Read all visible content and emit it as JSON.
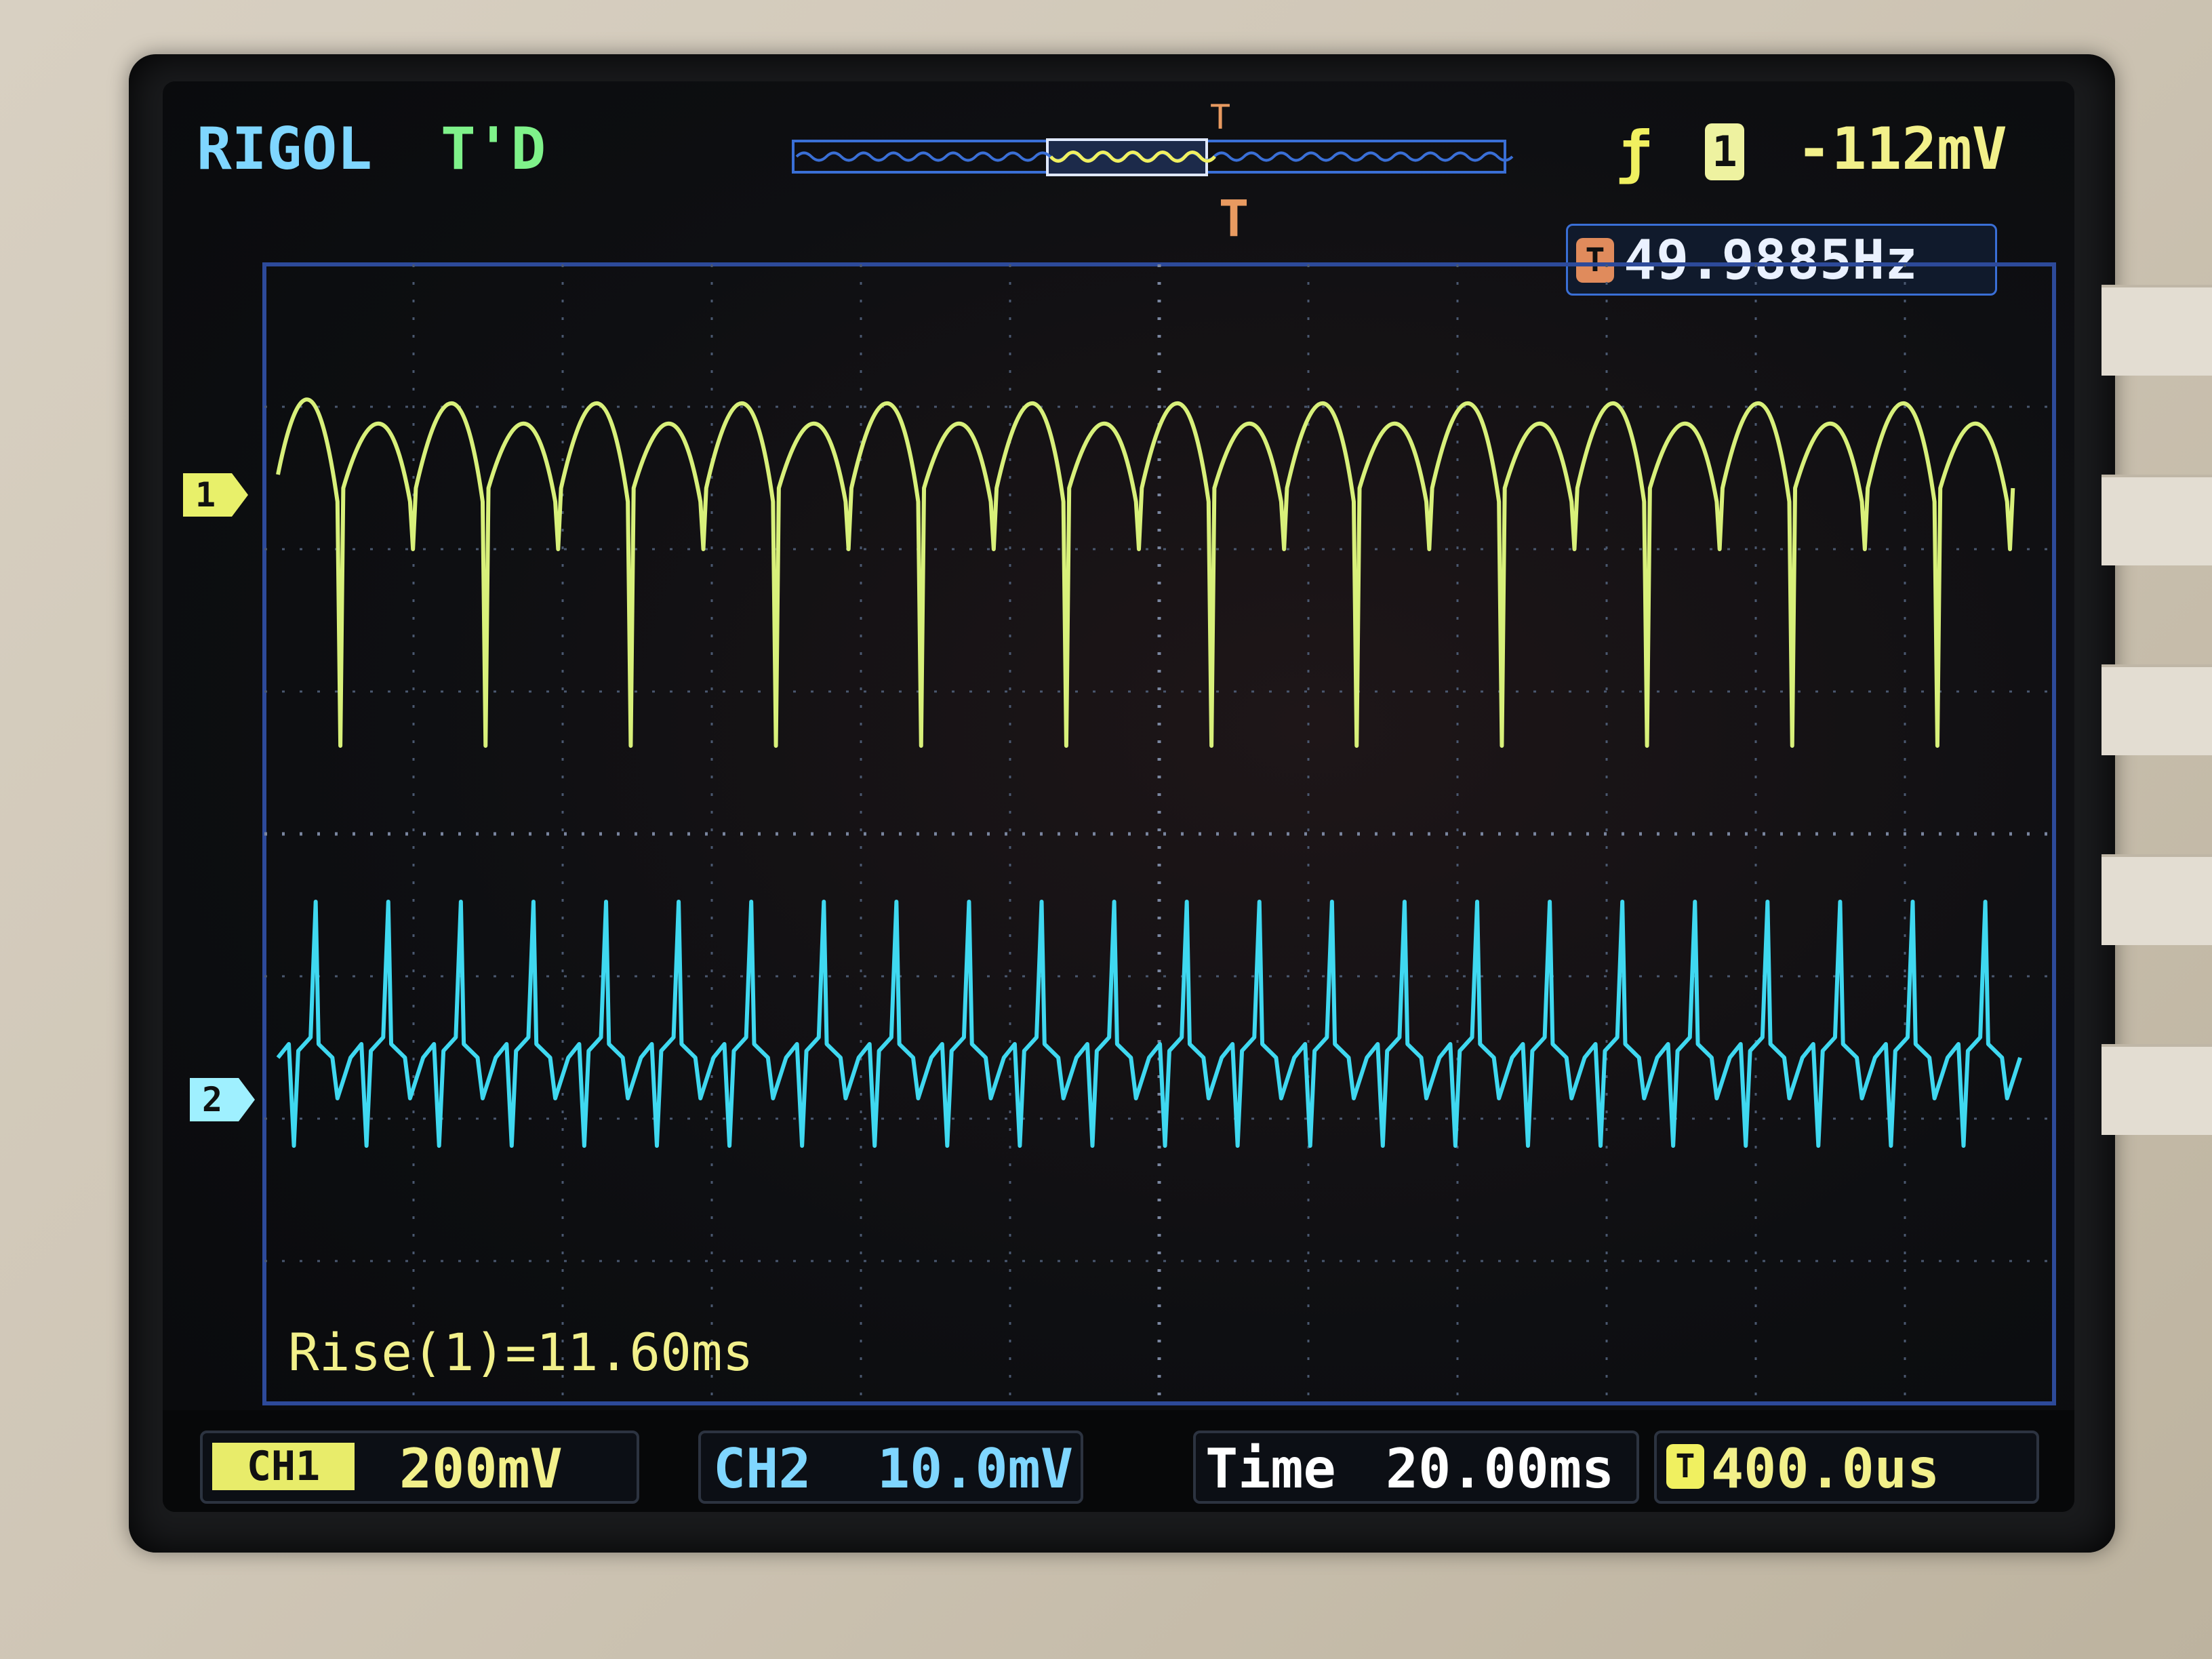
{
  "header": {
    "brand": "RIGOL",
    "trigger_status": "T'D",
    "trigger_source": "1",
    "trigger_level": "-112mV",
    "edge_icon": "rising-edge-icon"
  },
  "measurement": {
    "frequency": "49.9885Hz",
    "rise": "Rise(1)=11.60ms"
  },
  "markers": {
    "ch1": "1",
    "ch2": "2",
    "trigger": "T"
  },
  "status_bar": {
    "ch1_label": "CH1",
    "ch1_scale": "200mV",
    "ch2_label": "CH2",
    "ch2_scale": "10.0mV",
    "time_label": "Time",
    "time_value": "20.00ms",
    "trigger_delay": "400.0us"
  },
  "colors": {
    "ch1": "#d8f07a",
    "ch2": "#3fd8f0",
    "grid": "#4a5870",
    "accent": "#e08b5c"
  },
  "waveforms": {
    "ch1_period_count": 12,
    "ch2_spike_count": 24
  }
}
